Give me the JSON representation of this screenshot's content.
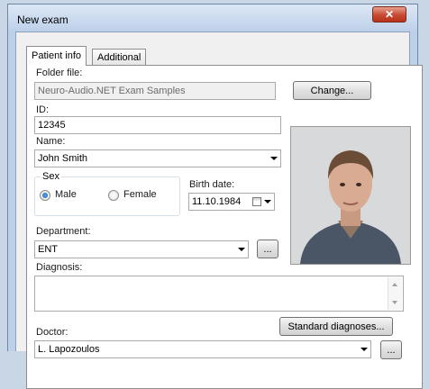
{
  "window": {
    "title": "New exam",
    "close_glyph": "✕"
  },
  "tabs": [
    {
      "label": "Patient info",
      "active": true
    },
    {
      "label": "Additional",
      "active": false
    }
  ],
  "folder": {
    "label": "Folder file:",
    "value": "Neuro-Audio.NET Exam Samples",
    "change_button": "Change..."
  },
  "id": {
    "label": "ID:",
    "value": "12345"
  },
  "name": {
    "label": "Name:",
    "value": "John Smith"
  },
  "sex": {
    "label": "Sex",
    "options": [
      "Male",
      "Female"
    ],
    "selected": "Male"
  },
  "birth": {
    "label": "Birth date:",
    "value": "11.10.1984"
  },
  "department": {
    "label": "Department:",
    "value": "ENT",
    "browse_button": "..."
  },
  "diagnosis": {
    "label": "Diagnosis:",
    "value": "",
    "standard_button": "Standard diagnoses..."
  },
  "doctor": {
    "label": "Doctor:",
    "value": "L. Lapozoulos",
    "browse_button": "..."
  },
  "icons": {
    "close": "close-icon",
    "calendar": "calendar-icon",
    "dropdown": "chevron-down-icon"
  },
  "colors": {
    "title_bar": "#bcd0ea",
    "close_button": "#c74a33",
    "radio_selected": "#1b5fb3"
  }
}
